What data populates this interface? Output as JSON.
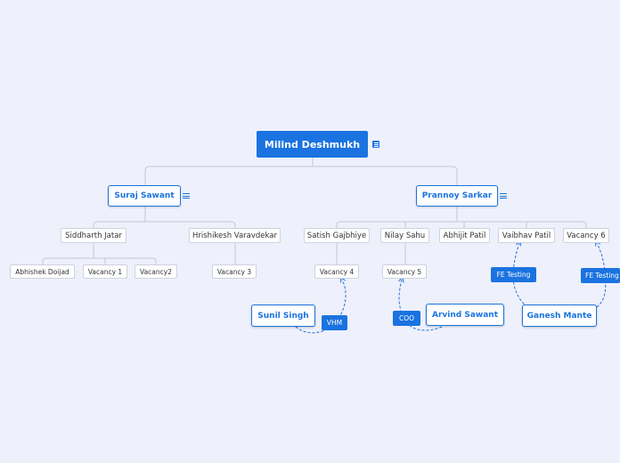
{
  "root": {
    "label": "Milind Deshmukh",
    "icon": "note-icon"
  },
  "branches": {
    "suraj": {
      "label": "Suraj Sawant",
      "icon": "note-icon"
    },
    "prannoy": {
      "label": "Prannoy Sarkar",
      "icon": "note-icon"
    }
  },
  "subs": {
    "siddharth": "Siddharth Jatar",
    "hrishikesh": "Hrishikesh Varavdekar",
    "satish": "Satish Gajbhiye",
    "nilay": "Nilay Sahu",
    "abhijit": "Abhijit Patil",
    "vaibhav": "Vaibhav Patil",
    "vacancy6": "Vacancy 6"
  },
  "leaves": {
    "abhishek": "Abhishek Doijad",
    "vacancy1": "Vacancy 1",
    "vacancy2": "Vacancy2",
    "vacancy3": "Vacancy 3",
    "vacancy4": "Vacancy 4",
    "vacancy5": "Vacancy 5"
  },
  "floating": {
    "sunil": "Sunil Singh",
    "arvind": "Arvind Sawant",
    "ganesh": "Ganesh Mante"
  },
  "relations": {
    "vhm": "VHM",
    "coo": "COO",
    "fe1": "FE Testing",
    "fe2": "FE Testing"
  },
  "colors": {
    "accent": "#1a73e0",
    "background": "#eef0fb",
    "connector": "#c4c8d6"
  }
}
